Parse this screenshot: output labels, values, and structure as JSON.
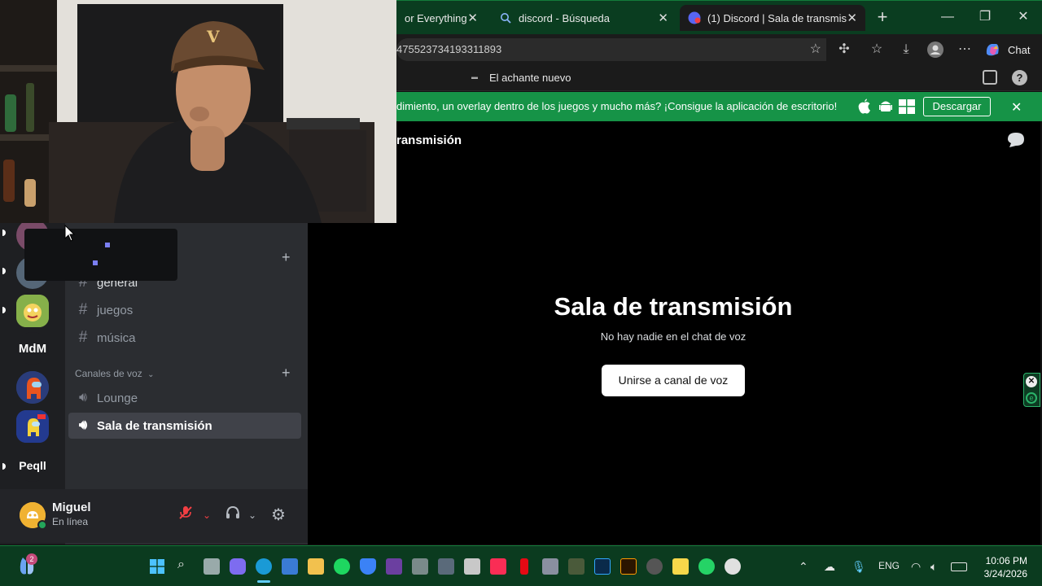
{
  "browser": {
    "tabs": [
      {
        "title": "or Everything - T",
        "active": false
      },
      {
        "title": "discord - Búsqueda",
        "active": false
      },
      {
        "title": "(1) Discord | Sala de transmisión",
        "active": true
      }
    ],
    "url_fragment": "475523734193311893",
    "bookmark": "El achante nuevo",
    "chat_label": "Chat"
  },
  "banner": {
    "text": "dimiento, un overlay dentro de los juegos y mucho más? ¡Consigue la aplicación de escritorio!",
    "download_label": "Descargar"
  },
  "servers": [
    {
      "label": ""
    },
    {
      "label": ""
    },
    {
      "label": ""
    },
    {
      "label": "MdM"
    },
    {
      "label": ""
    },
    {
      "label": ""
    },
    {
      "label": "Peqll"
    }
  ],
  "channels": {
    "text_channels": [
      "general",
      "juegos",
      "música"
    ],
    "voice_category": "Canales de voz",
    "voice_channels": [
      "Lounge",
      "Sala de transmisión"
    ]
  },
  "user": {
    "name": "Miguel",
    "status": "En línea"
  },
  "main": {
    "header": "ransmisión",
    "title": "Sala de transmisión",
    "subtitle": "No hay nadie en el chat de voz",
    "join_label": "Unirse a canal de voz"
  },
  "taskbar": {
    "badge": "2",
    "lang": "ENG",
    "time": "10:06 PM",
    "date": "3/24/2026"
  },
  "colors": {
    "banner": "#169347",
    "taskbar": "#0b3b1f",
    "discord_sidebar": "#2b2d31"
  }
}
